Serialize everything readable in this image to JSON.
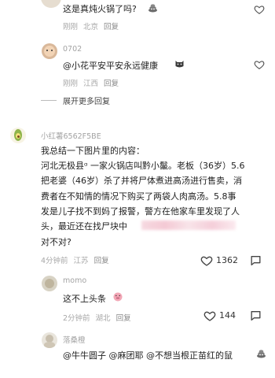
{
  "comments": [
    {
      "text": "这是真炖火锅了吗?",
      "time": "刚刚",
      "location": "北京",
      "reply": "回复"
    },
    {
      "username": "0702",
      "text": "@小花平安平安永远健康",
      "time": "刚刚",
      "location": "江西",
      "reply": "回复"
    }
  ],
  "expand_more": "展开更多回复",
  "main_comment": {
    "username": "小红薯6562F5BE",
    "lines": [
      "我总结一下图片里的内容：",
      "河北无极县ᵅ 一家火锅店叫黔小鬣。老板（36岁）5.6",
      "把老婆（46岁）杀了并将尸体煮进高汤进行售卖，消",
      "费者在不知情的情况下购买了两袋人肉高汤。5.8事",
      "发是儿子找不到妈了报警，警方在他家车里发现了人",
      "头，最近还在找尸块中",
      "对不对?"
    ],
    "time": "4分钟前",
    "location": "江苏",
    "reply": "回复",
    "likes": "1362"
  },
  "replies": [
    {
      "username": "momo",
      "text": "这不上头条",
      "time": "2分钟前",
      "location": "湖北",
      "reply": "回复",
      "likes": "144"
    },
    {
      "username": "落桑橙",
      "text": "@牛牛圆子 @麻团耶 @不想当根正苗红的鼠"
    }
  ]
}
